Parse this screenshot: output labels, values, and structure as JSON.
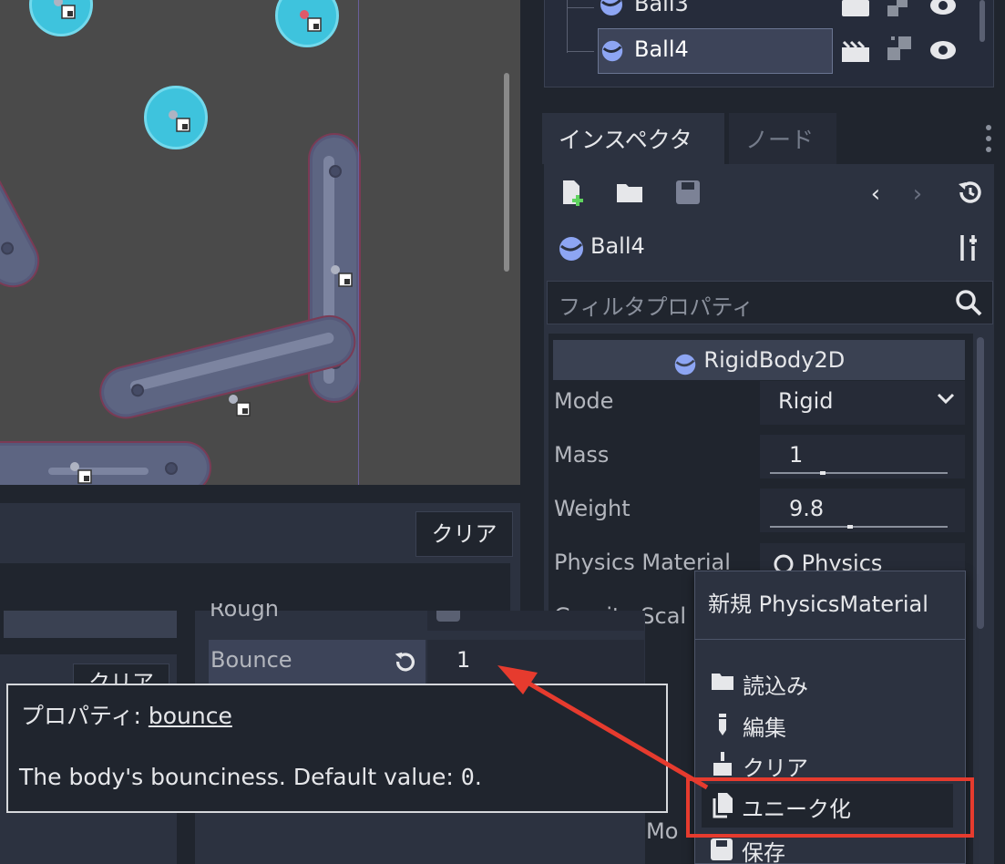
{
  "scene_tree": {
    "rows": [
      {
        "label": "Ball3"
      },
      {
        "label": "Ball4"
      }
    ]
  },
  "inspector": {
    "tab_inspector": "インスペクタ",
    "tab_node": "ノード",
    "node_name": "Ball4",
    "filter_placeholder": "フィルタプロパティ",
    "section": "RigidBody2D",
    "properties": {
      "mode_label": "Mode",
      "mode_value": "Rigid",
      "mass_label": "Mass",
      "mass_value": "1",
      "weight_label": "Weight",
      "weight_value": "9.8",
      "physics_material_label": "Physics Material",
      "physics_material_value": "Physics",
      "gravity_scale_label": "Gravity Scal",
      "contact_monitor_label": "Contact Mo"
    }
  },
  "popup_menu": {
    "items": [
      {
        "label": "新規 PhysicsMaterial",
        "icon": "none"
      },
      {
        "label": "読込み",
        "icon": "folder-icon"
      },
      {
        "label": "編集",
        "icon": "edit-icon"
      },
      {
        "label": "クリア",
        "icon": "broom-icon"
      },
      {
        "label": "ユニーク化",
        "icon": "duplicate-icon"
      },
      {
        "label": "保存",
        "icon": "save-icon"
      }
    ]
  },
  "bottom_panel": {
    "clear_label": "クリア",
    "clear_label_2": "クリア",
    "rough_label": "Rough",
    "bounce_label": "Bounce",
    "bounce_value": "1"
  },
  "tooltip": {
    "prefix": "プロパティ: ",
    "property": "bounce",
    "desc_before": "The body's bounciness. Default value: ",
    "desc_code": "0",
    "desc_after": "."
  },
  "colors": {
    "accent_red": "#e63b2e",
    "ball": "#3ec3dd",
    "panel": "#2c3240"
  }
}
